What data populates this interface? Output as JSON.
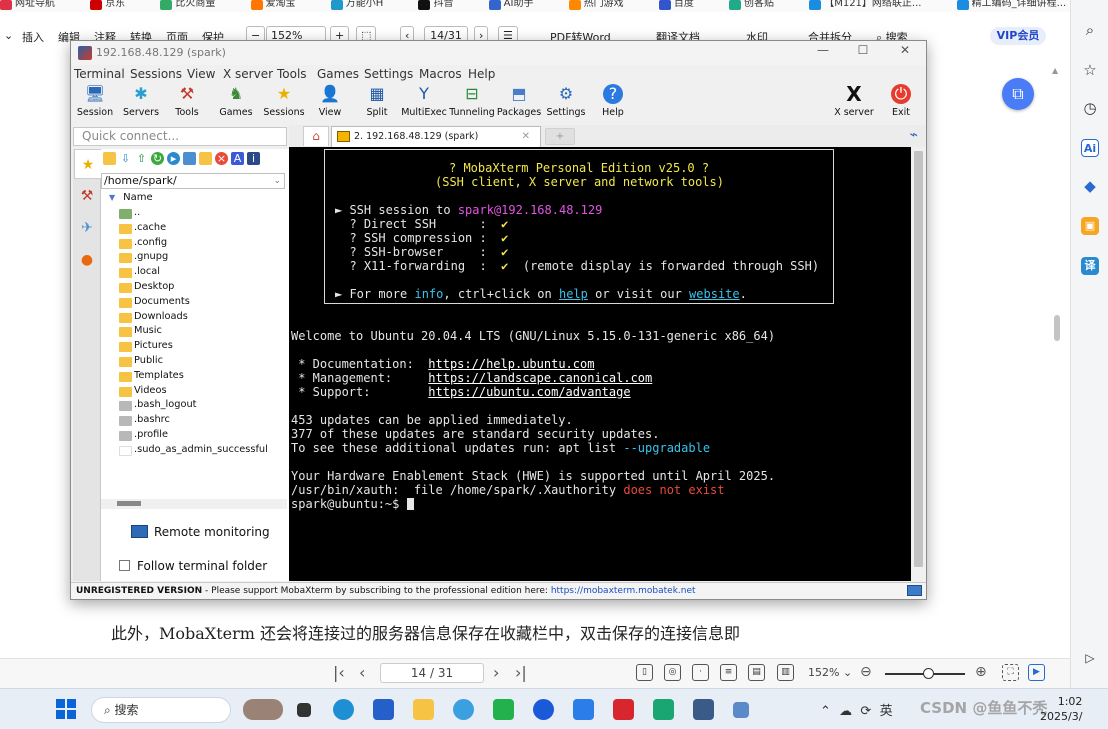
{
  "bookmarks": [
    "网址导航",
    "京东",
    "比火商量",
    "爱淘宝",
    "万能小H",
    "抖音",
    "AI助手",
    "热门游戏",
    "百度",
    "创客贴",
    "【M121】网络联正...",
    "精工编码_详细讲程..."
  ],
  "ribbon": {
    "items": [
      "插入",
      "编辑",
      "注释",
      "转换",
      "页面",
      "保护"
    ],
    "zoom": "152%",
    "page": "14/31",
    "pdf_to_word": "PDF转Word",
    "translate": "翻译文档",
    "watermark": "水印",
    "merge_split": "合并拆分",
    "search": "搜索",
    "vip": "VIP会员"
  },
  "document": {
    "body_text": "此外，MobaXterm 还会将连接过的服务器信息保存在收藏栏中，双击保存的连接信息即"
  },
  "pdf_status": {
    "page": "14 / 31",
    "zoom": "152%"
  },
  "moba": {
    "title": "192.168.48.129 (spark)",
    "menu": [
      "Terminal",
      "Sessions",
      "View",
      "X server",
      "Tools",
      "Games",
      "Settings",
      "Macros",
      "Help"
    ],
    "toolbar": [
      "Session",
      "Servers",
      "Tools",
      "Games",
      "Sessions",
      "View",
      "Split",
      "MultiExec",
      "Tunneling",
      "Packages",
      "Settings",
      "Help"
    ],
    "toolbar_right": [
      "X server",
      "Exit"
    ],
    "quick_connect_placeholder": "Quick connect...",
    "path": "/home/spark/",
    "file_header": "Name",
    "files": [
      {
        "name": "..",
        "type": "up"
      },
      {
        "name": ".cache",
        "type": "folder"
      },
      {
        "name": ".config",
        "type": "folder"
      },
      {
        "name": ".gnupg",
        "type": "folder"
      },
      {
        "name": ".local",
        "type": "folder"
      },
      {
        "name": "Desktop",
        "type": "folder"
      },
      {
        "name": "Documents",
        "type": "folder"
      },
      {
        "name": "Downloads",
        "type": "folder"
      },
      {
        "name": "Music",
        "type": "folder"
      },
      {
        "name": "Pictures",
        "type": "folder"
      },
      {
        "name": "Public",
        "type": "folder"
      },
      {
        "name": "Templates",
        "type": "folder"
      },
      {
        "name": "Videos",
        "type": "folder"
      },
      {
        "name": ".bash_logout",
        "type": "file"
      },
      {
        "name": ".bashrc",
        "type": "file"
      },
      {
        "name": ".profile",
        "type": "file"
      },
      {
        "name": ".sudo_as_admin_successful",
        "type": "blank"
      }
    ],
    "remote_monitoring": "Remote monitoring",
    "follow_terminal": "Follow terminal folder",
    "tab_label": "2. 192.168.48.129 (spark)",
    "status_bar": {
      "unregistered": "UNREGISTERED VERSION",
      "message": " -  Please support MobaXterm by subscribing to the professional edition here: ",
      "link": "https://mobaxterm.mobatek.net"
    }
  },
  "terminal": {
    "banner_title": "? MobaXterm Personal Edition v25.0 ?",
    "banner_sub": "(SSH client, X server and network tools)",
    "ssh_prefix": "► SSH session to ",
    "ssh_target": "spark@192.168.48.129",
    "features": [
      {
        "name": "  ? Direct SSH      :  ",
        "value": "✔",
        "note": ""
      },
      {
        "name": "  ? SSH compression :  ",
        "value": "✔",
        "note": ""
      },
      {
        "name": "  ? SSH-browser     :  ",
        "value": "✔",
        "note": ""
      },
      {
        "name": "  ? X11-forwarding  :  ",
        "value": "✔",
        "note": "  (remote display is forwarded through SSH)"
      }
    ],
    "more_prefix": "► For more ",
    "more_info": "info",
    "more_mid": ", ctrl+click on ",
    "more_help": "help",
    "more_mid2": " or visit our ",
    "more_website": "website",
    "more_end": ".",
    "welcome": "Welcome to Ubuntu 20.04.4 LTS (GNU/Linux 5.15.0-131-generic x86_64)",
    "doc_label": " * Documentation:  ",
    "doc_url": "https://help.ubuntu.com",
    "mgmt_label": " * Management:     ",
    "mgmt_url": "https://landscape.canonical.com",
    "support_label": " * Support:        ",
    "support_url": "https://ubuntu.com/advantage",
    "updates1": "453 updates can be applied immediately.",
    "updates2": "377 of these updates are standard security updates.",
    "updates3_prefix": "To see these additional updates run: apt list ",
    "updates3_flag": "--upgradable",
    "hwe": "Your Hardware Enablement Stack (HWE) is supported until April 2025.",
    "xauth_prefix": "/usr/bin/xauth:  file /home/spark/.Xauthority ",
    "xauth_err": "does not exist",
    "prompt": "spark@ubuntu:~$ "
  },
  "taskbar": {
    "search": "搜索",
    "tray": "英",
    "time": "1:02",
    "date": "2025/3/",
    "watermark": "CSDN @鱼鱼不秃"
  },
  "colors": {
    "terminal_bg": "#000000",
    "banner_yellow": "#f2e84a",
    "ssh_magenta": "#e255e2",
    "link_cyan": "#39c3ea",
    "error_red": "#e84b3a"
  }
}
